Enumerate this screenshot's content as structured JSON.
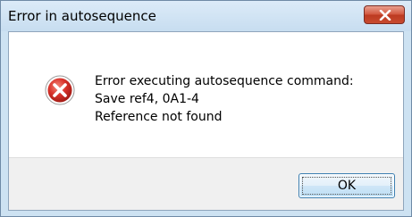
{
  "window": {
    "title": "Error in autosequence"
  },
  "dialog": {
    "icon": "error-icon",
    "message_lines": [
      "Error executing autosequence command:",
      "Save ref4, 0A1-4",
      "Reference not found"
    ]
  },
  "buttons": {
    "ok_label": "OK"
  },
  "colors": {
    "close_button": "#c84b2f",
    "error_icon": "#d8322a",
    "client_background": "#f0f0f0",
    "frame": "#cde2f2"
  }
}
